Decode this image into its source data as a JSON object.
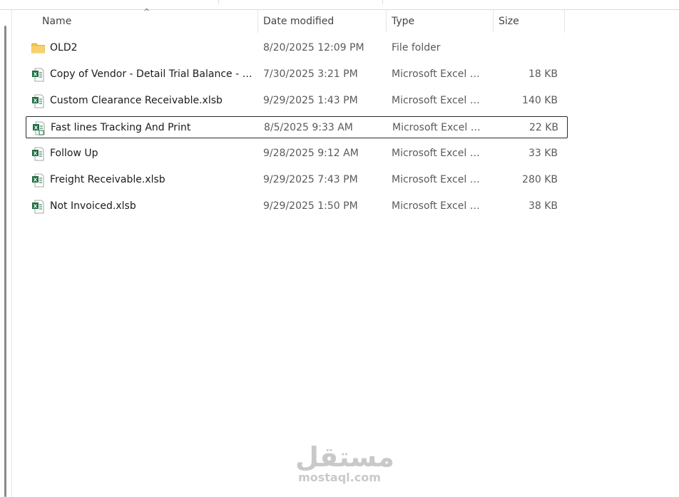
{
  "columns": {
    "name": "Name",
    "date": "Date modified",
    "type": "Type",
    "size": "Size"
  },
  "files": [
    {
      "icon": "folder-icon",
      "name": "OLD2",
      "date": "8/20/2025 12:09 PM",
      "type": "File folder",
      "size": ""
    },
    {
      "icon": "excel-icon",
      "name": "Copy of Vendor - Detail Trial Balance - E...",
      "date": "7/30/2025 3:21 PM",
      "type": "Microsoft Excel W...",
      "size": "18 KB"
    },
    {
      "icon": "excel-icon",
      "name": "Custom Clearance Receivable.xlsb",
      "date": "9/29/2025 1:43 PM",
      "type": "Microsoft Excel W...",
      "size": "140 KB"
    },
    {
      "icon": "excel-macro-icon",
      "name": "Fast lines Tracking And Print",
      "date": "8/5/2025 9:33 AM",
      "type": "Microsoft Excel M...",
      "size": "22 KB",
      "selected": true
    },
    {
      "icon": "excel-icon",
      "name": "Follow Up",
      "date": "9/28/2025 9:12 AM",
      "type": "Microsoft Excel W...",
      "size": "33 KB"
    },
    {
      "icon": "excel-icon",
      "name": "Freight Receivable.xlsb",
      "date": "9/29/2025 7:43 PM",
      "type": "Microsoft Excel W...",
      "size": "280 KB"
    },
    {
      "icon": "excel-icon",
      "name": "Not Invoiced.xlsb",
      "date": "9/29/2025 1:50 PM",
      "type": "Microsoft Excel W...",
      "size": "38 KB"
    }
  ],
  "watermark": {
    "arabic": "مستقل",
    "latin": "mostaql.com"
  },
  "colors": {
    "excel_green": "#1d6f42",
    "folder_yellow": "#f2c14e",
    "selection_border": "#2b2b2b"
  }
}
